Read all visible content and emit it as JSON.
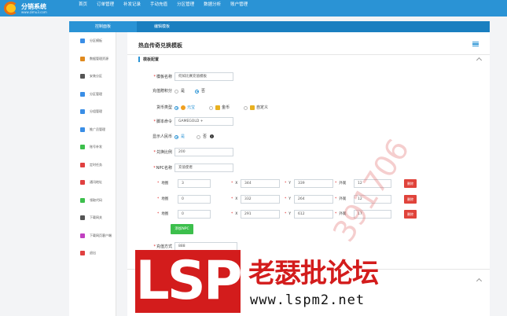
{
  "brand": {
    "name": "分销系统",
    "subtitle": "www.zimu3.com"
  },
  "top_menu": [
    "首页",
    "订单管理",
    "补发记录",
    "手动充值",
    "分区管理",
    "数据分析",
    "账户管理"
  ],
  "tabs": {
    "active": "控制面板",
    "current": "编辑模板"
  },
  "sidebar": [
    {
      "label": "分区模板",
      "icon": "template-icon",
      "color": "#3a8ee6"
    },
    {
      "label": "数据管理资源",
      "icon": "pencil-icon",
      "color": "#e08a1e"
    },
    {
      "label": "安装分区",
      "icon": "wrench-icon",
      "color": "#555555"
    },
    {
      "label": "分区管理",
      "icon": "inbox-icon",
      "color": "#3a8ee6"
    },
    {
      "label": "分组管理",
      "icon": "document-icon",
      "color": "#3a8ee6"
    },
    {
      "label": "推广员管理",
      "icon": "copy-icon",
      "color": "#3a8ee6"
    },
    {
      "label": "账号补发",
      "icon": "money-icon",
      "color": "#3cbf4c"
    },
    {
      "label": "定时任务",
      "icon": "mobile-icon",
      "color": "#e04040"
    },
    {
      "label": "通讯地址",
      "icon": "pin-icon",
      "color": "#e04040"
    },
    {
      "label": "领取代码",
      "icon": "gift-icon",
      "color": "#3cbf4c"
    },
    {
      "label": "下载网关",
      "icon": "wrench-icon",
      "color": "#555555"
    },
    {
      "label": "下载网页客户端",
      "icon": "gem-icon",
      "color": "#c040c0"
    },
    {
      "label": "退出",
      "icon": "power-icon",
      "color": "#e04040"
    }
  ],
  "page": {
    "title": "热血传奇兑换模板",
    "section": "模板配置",
    "fields": {
      "template_name": {
        "label": "模板名称",
        "value": "何如比赛充值模板"
      },
      "enable_points": {
        "label": "充值赠积分",
        "options": [
          "是",
          "否"
        ],
        "selected": "否"
      },
      "currency_type": {
        "label": "货币类型",
        "options": [
          "元宝",
          "金币",
          "自定义"
        ],
        "selected": "元宝"
      },
      "script_command": {
        "label": "脚本命令",
        "value": "GAMEGOLD +"
      },
      "show_rmb": {
        "label": "显示人民币",
        "options": [
          "是",
          "否"
        ],
        "selected": "是"
      },
      "exchange_ratio": {
        "label": "兑换比例",
        "value": "200"
      },
      "npc_name": {
        "label": "NPC名称",
        "value": "充值使者"
      },
      "map_label": "地图",
      "x_label": "X",
      "y_label": "Y",
      "look_label": "外观",
      "npcs": [
        {
          "map": "3",
          "x": "344",
          "y": "339",
          "look": "12"
        },
        {
          "map": "0",
          "x": "332",
          "y": "264",
          "look": "12"
        },
        {
          "map": "0",
          "x": "291",
          "y": "612",
          "look": "17"
        }
      ],
      "delete_label": "删除",
      "add_npc_label": "添加NPC",
      "recharge_method": {
        "label": "充值方式",
        "value": "888"
      }
    }
  },
  "watermark": {
    "logo": "LSP",
    "name": "老瑟批论坛",
    "url": "www.lspm2.net",
    "diagonal": "391706"
  }
}
